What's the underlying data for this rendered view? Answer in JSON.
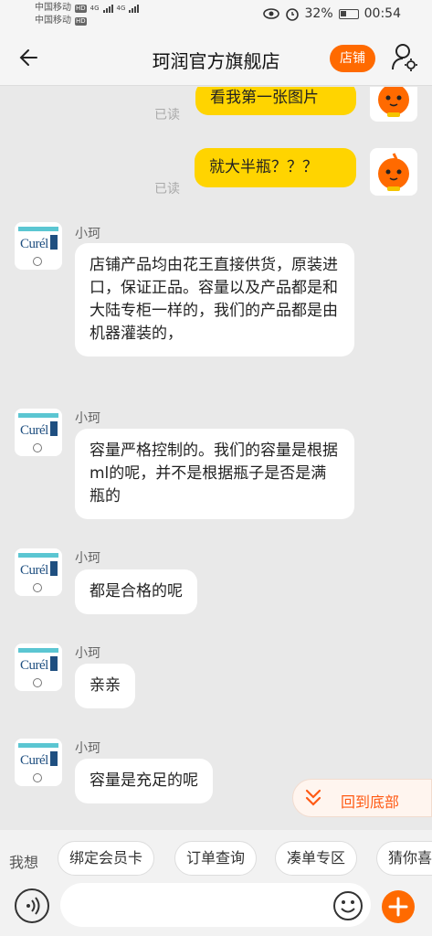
{
  "status_bar": {
    "carrier_1": "中国移动",
    "carrier_2": "中国移动",
    "hd": "HD",
    "network": "4G",
    "battery": "32%",
    "time": "00:54"
  },
  "header": {
    "title": "珂润官方旗舰店",
    "store_button": "店铺"
  },
  "messages": [
    {
      "side": "self",
      "text": "看我第一张图片",
      "status": "已读"
    },
    {
      "side": "self",
      "text": "就大半瓶？？？",
      "status": "已读"
    },
    {
      "side": "other",
      "sender": "小珂",
      "text": "店铺产品均由花王直接供货，原装进口，保证正品。容量以及产品都是和大陆专柜一样的，我们的产品都是由机器灌装的，"
    },
    {
      "side": "other",
      "sender": "小珂",
      "text": "容量严格控制的。我们的容量是根据ml的呢，并不是根据瓶子是否是满瓶的"
    },
    {
      "side": "other",
      "sender": "小珂",
      "text": "都是合格的呢"
    },
    {
      "side": "other",
      "sender": "小珂",
      "text": "亲亲"
    },
    {
      "side": "other",
      "sender": "小珂",
      "text": "容量是充足的呢"
    }
  ],
  "shop_avatar": {
    "logo_text": "Curél"
  },
  "back_to_bottom": "回到底部",
  "quick_bar": {
    "label": "我想",
    "chips": [
      "绑定会员卡",
      "订单查询",
      "凑单专区",
      "猜你喜"
    ]
  },
  "input": {
    "value": "",
    "placeholder": ""
  },
  "colors": {
    "accent": "#ff6a00",
    "self_bubble": "#ffd400",
    "background": "#e9e9e9"
  },
  "icons": {
    "back": "back-arrow-icon",
    "user": "user-settings-icon",
    "voice": "voice-icon",
    "emoji": "emoji-icon",
    "plus": "plus-icon",
    "chevron": "double-chevron-down-icon"
  }
}
